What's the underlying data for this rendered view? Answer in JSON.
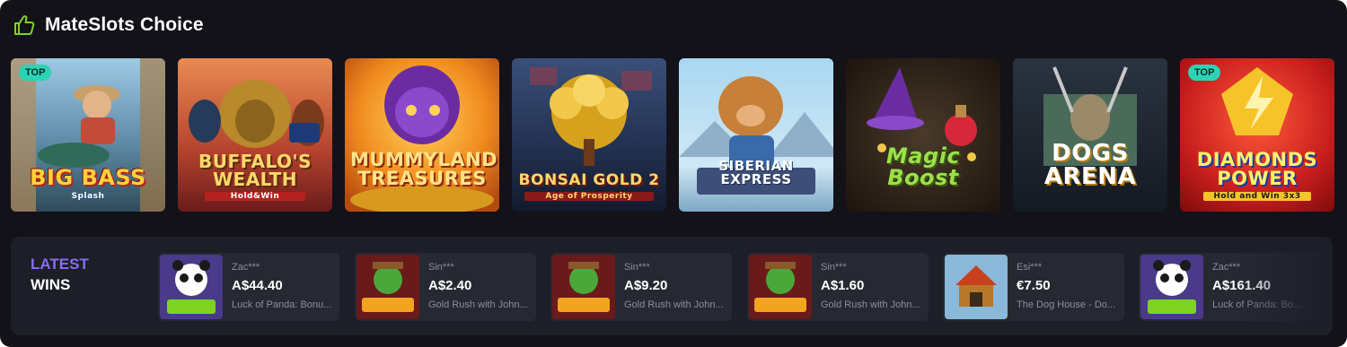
{
  "header": {
    "title": "MateSlots Choice",
    "icon": "thumbs-up-icon"
  },
  "colors": {
    "accent_green": "#7ed321",
    "badge": "#2bd3b4",
    "latest_label": "#8a6cf5",
    "panel_bg": "#121218"
  },
  "games": [
    {
      "title": "Big Bass",
      "subtitle": "Splash",
      "badge": "TOP"
    },
    {
      "title": "Buffalo's Wealth",
      "subtitle": "Hold&Win",
      "badge": ""
    },
    {
      "title": "Mummyland Treasures",
      "subtitle": "",
      "badge": ""
    },
    {
      "title": "Bonsai Gold 2",
      "subtitle": "Age of Prosperity",
      "badge": ""
    },
    {
      "title": "Siberian Express",
      "subtitle": "",
      "badge": ""
    },
    {
      "title": "Magic Boost",
      "subtitle": "",
      "badge": ""
    },
    {
      "title": "Dogs Arena",
      "subtitle": "",
      "badge": ""
    },
    {
      "title": "Diamonds Power",
      "subtitle": "Hold and Win 3x3",
      "badge": "TOP"
    }
  ],
  "latest_wins": {
    "label_line1": "LATEST",
    "label_line2": "WINS",
    "items": [
      {
        "user": "Zac***",
        "amount": "A$44.40",
        "game": "Luck of Panda: Bonu..."
      },
      {
        "user": "Sin***",
        "amount": "A$2.40",
        "game": "Gold Rush with John..."
      },
      {
        "user": "Sin***",
        "amount": "A$9.20",
        "game": "Gold Rush with John..."
      },
      {
        "user": "Sin***",
        "amount": "A$1.60",
        "game": "Gold Rush with John..."
      },
      {
        "user": "Esi***",
        "amount": "€7.50",
        "game": "The Dog House - Do..."
      },
      {
        "user": "Zac***",
        "amount": "A$161.40",
        "game": "Luck of Panda: Bo..."
      }
    ]
  }
}
